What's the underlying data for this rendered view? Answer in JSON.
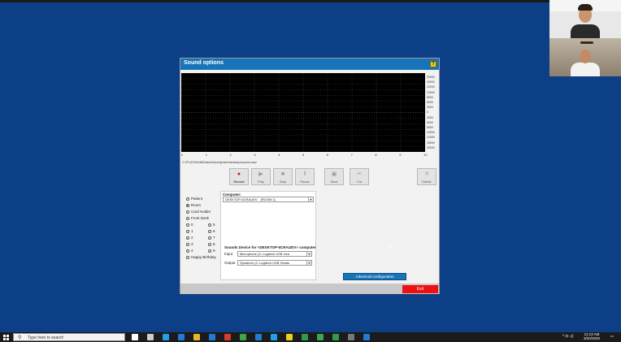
{
  "window": {
    "title": "Sound options"
  },
  "icons": {
    "help": "help-icon",
    "record": "record-icon",
    "play": "play-icon",
    "stop": "stop-icon",
    "pause": "pause-icon",
    "save": "save-icon",
    "cut": "cut-icon",
    "delete": "delete-icon",
    "search": "search-icon"
  },
  "scope": {
    "y_axis_labels": [
      "20000",
      "15000",
      "12000",
      "10000",
      "8000",
      "5000",
      "3000",
      "0",
      "3000",
      "5000",
      "8000",
      "10000",
      "12000",
      "15000",
      "20000"
    ],
    "x_axis_labels": [
      "0",
      "1",
      "2",
      "3",
      "4",
      "5",
      "6",
      "7",
      "8",
      "9",
      "10"
    ],
    "file_path": "C:\\PLATINUM\\Data\\Voice\\jester\\desktop\\sound.wav"
  },
  "toolbar": {
    "record": "Record",
    "play": "Play",
    "stop": "Stop",
    "pause": "Pause",
    "save": "Save",
    "cut": "Cut",
    "delete": "Delete"
  },
  "options": {
    "single": [
      "Patient",
      "Room",
      "Card Holder",
      "Front Desk"
    ],
    "selected": "Room",
    "numbers_left": [
      "0",
      "1",
      "2",
      "3",
      "4"
    ],
    "numbers_right": [
      "5",
      "6",
      "7",
      "8",
      "9"
    ],
    "birthday": "Happy Birthday"
  },
  "computer": {
    "label": "Computer:",
    "name": "DESKTOP-6CRAUDV",
    "room": "[ROOM 1]",
    "sounds_label": "Sounds Device for <DESKTOP-6CRAUDV> computer",
    "input_label": "Input",
    "input_value": "Microphone (3- Logitech USB Hea",
    "output_label": "Output",
    "output_value": "Speakers (3- Logitech USB Heads"
  },
  "buttons": {
    "advanced": "Advanced configuration",
    "exit": "Exit"
  },
  "taskbar": {
    "search_placeholder": "Type here to search",
    "time": "11:13 AM",
    "date": "3/20/2020",
    "app_colors": [
      "#ffffff",
      "#cccccc",
      "#1fa0e8",
      "#1f7bd6",
      "#e8b428",
      "#1f7bd6",
      "#d83b2a",
      "#3ba64a",
      "#1f7bd6",
      "#1fa0e8",
      "#e6d31a",
      "#2e9c4e",
      "#3ba64a",
      "#2e9c4e",
      "#777777",
      "#1f7bd6"
    ]
  },
  "colors": {
    "desktop": "#0d3f87",
    "titlebar": "#1874b8",
    "exit": "#ee1111"
  }
}
